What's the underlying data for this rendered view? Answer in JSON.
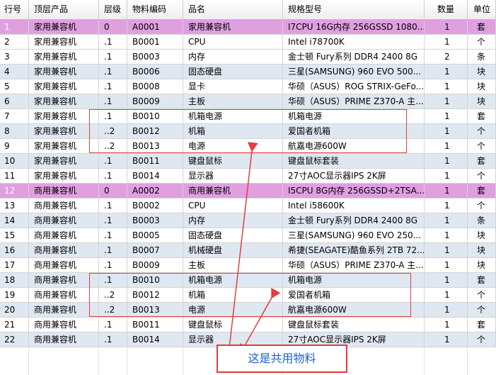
{
  "table": {
    "columns": [
      "行号",
      "顶层产品",
      "层级",
      "物料编码",
      "品名",
      "规格型号",
      "数量",
      "单位"
    ],
    "rows": [
      {
        "no": "1",
        "top": "家用兼容机",
        "level": "0",
        "code": "A0001",
        "name": "家用兼容机",
        "spec": "I7CPU 16G内存 256GSSD 1080...",
        "qty": "1",
        "unit": "套",
        "kind": "top"
      },
      {
        "no": "2",
        "top": "家用兼容机",
        "level": ".1",
        "code": "B0001",
        "name": "CPU",
        "spec": "Intel i78700K",
        "qty": "1",
        "unit": "个",
        "kind": "odd"
      },
      {
        "no": "3",
        "top": "家用兼容机",
        "level": ".1",
        "code": "B0003",
        "name": "内存",
        "spec": "金士顿 Fury系列 DDR4 2400 8G",
        "qty": "2",
        "unit": "条",
        "kind": "odd"
      },
      {
        "no": "4",
        "top": "家用兼容机",
        "level": ".1",
        "code": "B0006",
        "name": "固态硬盘",
        "spec": "三星(SAMSUNG) 960 EVO 500...",
        "qty": "1",
        "unit": "块",
        "kind": "even"
      },
      {
        "no": "5",
        "top": "家用兼容机",
        "level": ".1",
        "code": "B0008",
        "name": "显卡",
        "spec": "华硕（ASUS）ROG STRIX-GeFo...",
        "qty": "1",
        "unit": "块",
        "kind": "odd"
      },
      {
        "no": "6",
        "top": "家用兼容机",
        "level": ".1",
        "code": "B0009",
        "name": "主板",
        "spec": "华硕（ASUS）PRIME Z370-A 主...",
        "qty": "1",
        "unit": "块",
        "kind": "even"
      },
      {
        "no": "7",
        "top": "家用兼容机",
        "level": ".1",
        "code": "B0010",
        "name": "机箱电源",
        "spec": "机箱电源",
        "qty": "1",
        "unit": "套",
        "kind": "odd"
      },
      {
        "no": "8",
        "top": "家用兼容机",
        "level": "..2",
        "code": "B0012",
        "name": "机箱",
        "spec": "爱国者机箱",
        "qty": "1",
        "unit": "个",
        "kind": "even"
      },
      {
        "no": "9",
        "top": "家用兼容机",
        "level": "..2",
        "code": "B0013",
        "name": "电源",
        "spec": "航嘉电源600W",
        "qty": "1",
        "unit": "个",
        "kind": "odd"
      },
      {
        "no": "10",
        "top": "家用兼容机",
        "level": ".1",
        "code": "B0011",
        "name": "键盘鼠标",
        "spec": "键盘鼠标套装",
        "qty": "1",
        "unit": "套",
        "kind": "even"
      },
      {
        "no": "11",
        "top": "家用兼容机",
        "level": ".1",
        "code": "B0014",
        "name": "显示器",
        "spec": "27寸AOC显示器IPS 2K屏",
        "qty": "1",
        "unit": "个",
        "kind": "odd"
      },
      {
        "no": "12",
        "top": "商用兼容机",
        "level": "0",
        "code": "A0002",
        "name": "商用兼容机",
        "spec": "I5CPU 8G内存 256GSSD+2TSA...",
        "qty": "1",
        "unit": "套",
        "kind": "top"
      },
      {
        "no": "13",
        "top": "商用兼容机",
        "level": ".1",
        "code": "B0002",
        "name": "CPU",
        "spec": "Intel i58600K",
        "qty": "1",
        "unit": "个",
        "kind": "odd"
      },
      {
        "no": "14",
        "top": "商用兼容机",
        "level": ".1",
        "code": "B0003",
        "name": "内存",
        "spec": "金士顿 Fury系列 DDR4 2400 8G",
        "qty": "1",
        "unit": "条",
        "kind": "even"
      },
      {
        "no": "15",
        "top": "商用兼容机",
        "level": ".1",
        "code": "B0005",
        "name": "固态硬盘",
        "spec": "三星(SAMSUNG) 960 EVO 250...",
        "qty": "1",
        "unit": "块",
        "kind": "odd"
      },
      {
        "no": "16",
        "top": "商用兼容机",
        "level": ".1",
        "code": "B0007",
        "name": "机械硬盘",
        "spec": "希捷(SEAGATE)酷鱼系列 2TB 72...",
        "qty": "1",
        "unit": "块",
        "kind": "even"
      },
      {
        "no": "17",
        "top": "商用兼容机",
        "level": ".1",
        "code": "B0009",
        "name": "主板",
        "spec": "华硕（ASUS）PRIME Z370-A 主...",
        "qty": "1",
        "unit": "块",
        "kind": "odd"
      },
      {
        "no": "18",
        "top": "商用兼容机",
        "level": ".1",
        "code": "B0010",
        "name": "机箱电源",
        "spec": "机箱电源",
        "qty": "1",
        "unit": "套",
        "kind": "even"
      },
      {
        "no": "19",
        "top": "商用兼容机",
        "level": "..2",
        "code": "B0012",
        "name": "机箱",
        "spec": "爱国者机箱",
        "qty": "1",
        "unit": "个",
        "kind": "odd"
      },
      {
        "no": "20",
        "top": "商用兼容机",
        "level": "..2",
        "code": "B0013",
        "name": "电源",
        "spec": "航嘉电源600W",
        "qty": "1",
        "unit": "个",
        "kind": "even"
      },
      {
        "no": "21",
        "top": "商用兼容机",
        "level": ".1",
        "code": "B0011",
        "name": "键盘鼠标",
        "spec": "键盘鼠标套装",
        "qty": "1",
        "unit": "套",
        "kind": "odd"
      },
      {
        "no": "22",
        "top": "商用兼容机",
        "level": ".1",
        "code": "B0014",
        "name": "显示器",
        "spec": "27寸AOC显示器IPS 2K屏",
        "qty": "1",
        "unit": "个",
        "kind": "even"
      }
    ]
  },
  "annotation": {
    "callout_text": "这是共用物料",
    "box_color": "#e0403f",
    "text_color": "#1f5fd6",
    "top_row_color": "#e0a0e0",
    "alt_row_color": "#dfe7f1"
  }
}
